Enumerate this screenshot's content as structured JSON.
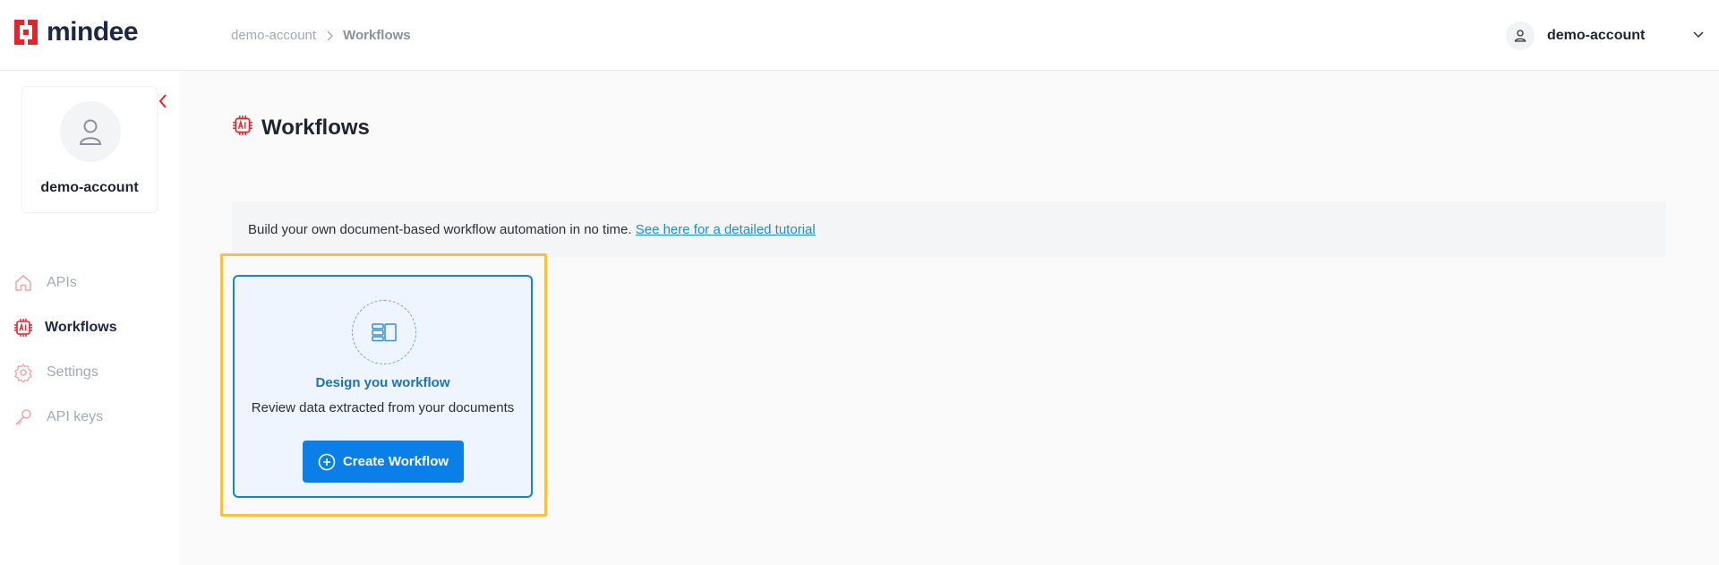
{
  "app": {
    "brand": "mindee",
    "brand_color": "#e3242b",
    "accent_color": "#0b7fe8"
  },
  "header": {
    "breadcrumb": {
      "root": "demo-account",
      "separator_icon": "chevron-right-icon",
      "current": "Workflows"
    },
    "account": {
      "name": "demo-account",
      "avatar_icon": "user-icon",
      "caret_icon": "chevron-down-icon"
    }
  },
  "sidebar": {
    "profile": {
      "name": "demo-account",
      "avatar_icon": "user-icon"
    },
    "collapse_icon": "chevron-left-icon",
    "items": [
      {
        "label": "APIs",
        "icon": "home-icon",
        "active": false
      },
      {
        "label": "Workflows",
        "icon": "ai-chip-icon",
        "active": true
      },
      {
        "label": "Settings",
        "icon": "gear-icon",
        "active": false
      },
      {
        "label": "API keys",
        "icon": "key-icon",
        "active": false
      }
    ]
  },
  "main": {
    "title": "Workflows",
    "title_icon": "ai-chip-icon",
    "info": {
      "text": "Build your own document-based workflow automation in no time.",
      "link": "See here for a detailed tutorial"
    },
    "card": {
      "icon": "layout-panels-icon",
      "title": "Design you workflow",
      "description": "Review data extracted from your documents",
      "button_label": "Create Workflow",
      "button_icon": "plus-circle-icon"
    }
  }
}
